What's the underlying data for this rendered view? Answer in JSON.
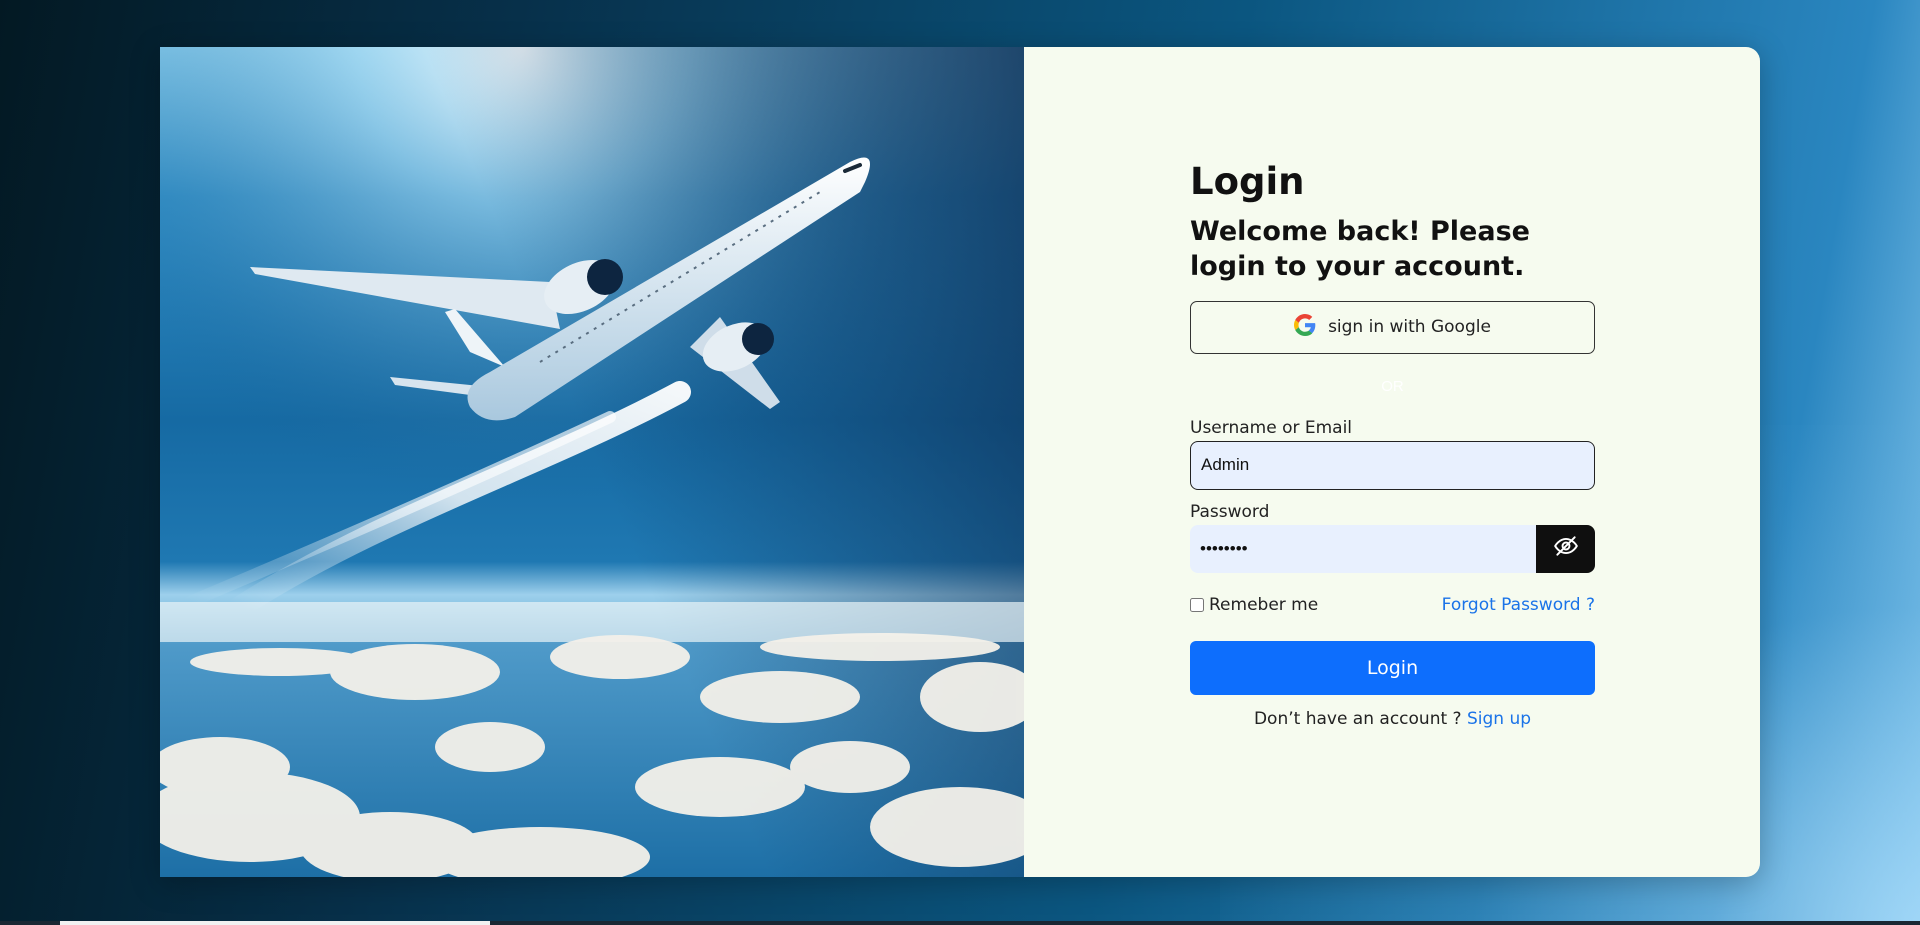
{
  "login": {
    "title": "Login",
    "subtitle": "Welcome back! Please login to your account.",
    "google_button_label": "sign in with Google",
    "divider_text": "OR",
    "username_label": "Username or Email",
    "username_value": "Admin",
    "password_label": "Password",
    "password_value": "password",
    "remember_label": "Remeber me",
    "forgot_link": "Forgot Password ?",
    "login_button": "Login",
    "signup_prompt": "Don’t have an account ?",
    "signup_link": "Sign up"
  },
  "icons": {
    "google": "google-g-logo",
    "toggle_password": "eye-slash-icon"
  },
  "colors": {
    "primary": "#0d6efd",
    "link": "#1a73e8",
    "panel_bg": "#f6fbef",
    "input_bg": "#e8f0fe",
    "eye_button_bg": "#0f0f0f"
  }
}
